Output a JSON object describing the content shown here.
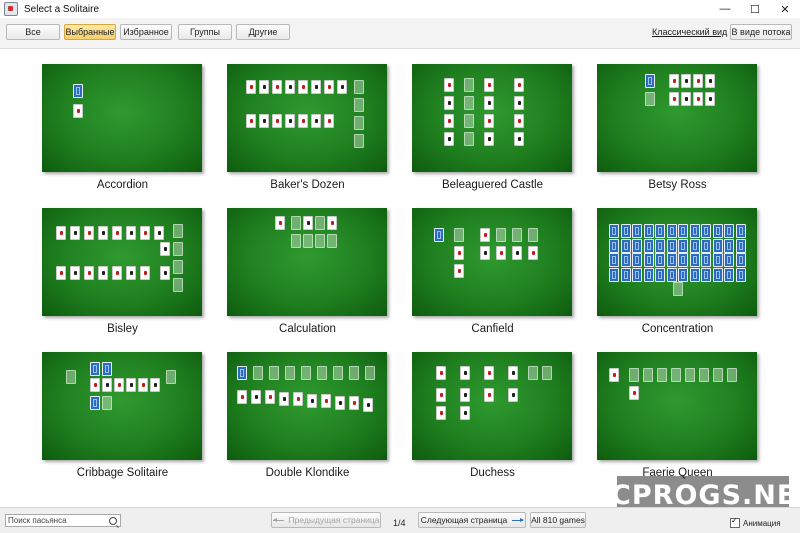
{
  "window": {
    "title": "Select a Solitaire",
    "minimize_glyph": "—",
    "maximize_glyph": "☐",
    "close_glyph": "✕"
  },
  "toolbar": {
    "tabs": [
      {
        "label": "Все",
        "active": false
      },
      {
        "label": "Выбранные",
        "active": true
      },
      {
        "label": "Избранное",
        "active": false
      },
      {
        "label": "Группы",
        "active": false
      },
      {
        "label": "Другие",
        "active": false
      }
    ],
    "classic_link": "Классический вид",
    "stream_button": "В виде потока"
  },
  "games": [
    {
      "name": "Accordion"
    },
    {
      "name": "Baker's Dozen"
    },
    {
      "name": "Beleaguered Castle"
    },
    {
      "name": "Betsy Ross"
    },
    {
      "name": "Bisley"
    },
    {
      "name": "Calculation"
    },
    {
      "name": "Canfield"
    },
    {
      "name": "Concentration"
    },
    {
      "name": "Cribbage Solitaire"
    },
    {
      "name": "Double Klondike"
    },
    {
      "name": "Duchess"
    },
    {
      "name": "Faerie Queen"
    }
  ],
  "statusbar": {
    "search_placeholder": "Поиск пасьянса",
    "prev_label": "Предыдущая страница",
    "page": "1/4",
    "next_label": "Следующая страница",
    "all_games": "All 810 games",
    "animation_label": "Анимация",
    "animation_checked": true
  },
  "watermark": "PCPROGS.NET",
  "colors": {
    "felt": "#1f7f1f",
    "active_tab": "#f7cf6a",
    "card_back": "#2c6cc0"
  }
}
